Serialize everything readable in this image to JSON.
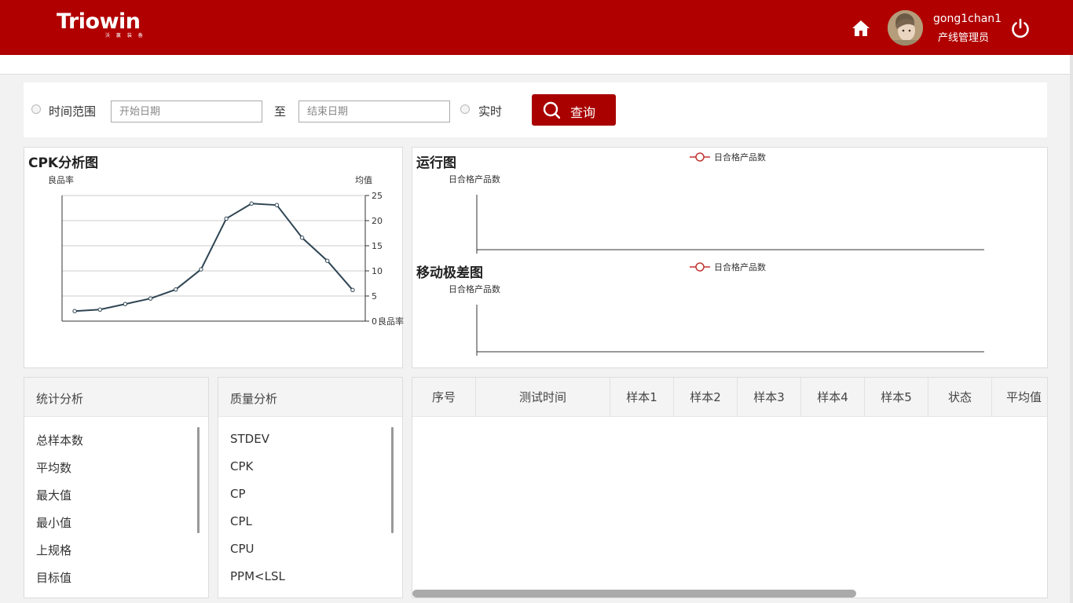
{
  "header": {
    "logo_text": "Triowin",
    "logo_sub": "沃 赢 装 备",
    "user_name": "gong1chan1",
    "user_role": "产线管理员",
    "icons": [
      "home-icon",
      "avatar",
      "power-icon"
    ]
  },
  "filter": {
    "time_range_label": "时间范围",
    "start_placeholder": "开始日期",
    "to_label": "至",
    "end_placeholder": "结束日期",
    "realtime_label": "实时",
    "query_label": "查询"
  },
  "cpk_chart": {
    "title": "CPK分析图",
    "left_axis_label": "良品率",
    "right_axis_label": "均值",
    "right_axis_end_label": "良品率",
    "chart_data": {
      "type": "line",
      "title": "CPK分析图",
      "xlabel": "",
      "ylabel_left": "良品率",
      "ylabel_right": "均值",
      "y_ticks": [
        "0",
        "5",
        "10",
        "15",
        "20",
        "25"
      ],
      "ylim": [
        0,
        25
      ],
      "grid": true,
      "values": [
        2,
        2.3,
        3.4,
        4.5,
        6.3,
        10.3,
        20.4,
        23.4,
        23.1,
        16.6,
        12,
        6.2
      ]
    }
  },
  "run_chart": {
    "title": "运行图",
    "legend": "日合格产品数",
    "y_label": "日合格产品数"
  },
  "moving_range_chart": {
    "title": "移动极差图",
    "legend": "日合格产品数",
    "y_label": "日合格产品数"
  },
  "stats_panel": {
    "title": "统计分析",
    "items": [
      "总样本数",
      "平均数",
      "最大值",
      "最小值",
      "上规格",
      "目标值"
    ]
  },
  "quality_panel": {
    "title": "质量分析",
    "items": [
      "STDEV",
      "CPK",
      "CP",
      "CPL",
      "CPU",
      "PPM<LSL"
    ]
  },
  "table": {
    "columns": [
      "序号",
      "测试时间",
      "样本1",
      "样本2",
      "样本3",
      "样本4",
      "样本5",
      "状态",
      "平均值"
    ]
  }
}
